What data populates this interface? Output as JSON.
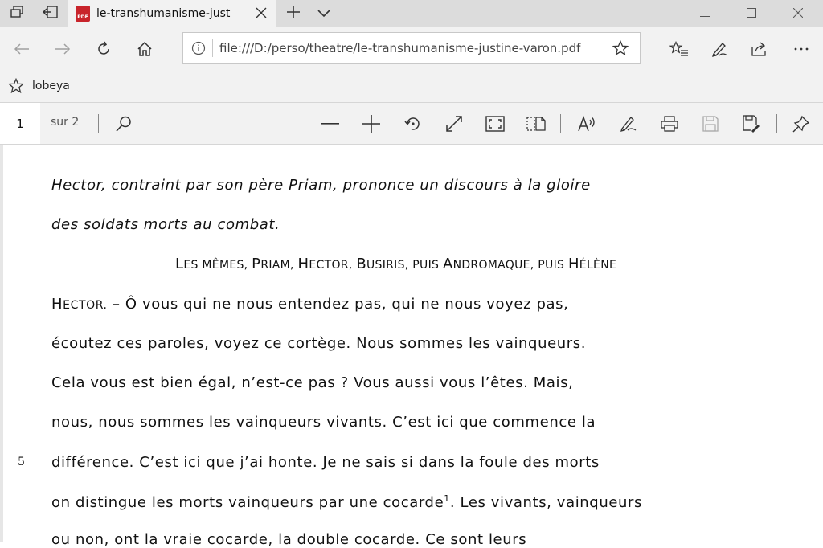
{
  "tab": {
    "title": "le-transhumanisme-just",
    "favicon_label": "PDF"
  },
  "address_bar": {
    "url": "file:///D:/perso/theatre/le-transhumanisme-justine-varon.pdf"
  },
  "favorites_bar": {
    "items": [
      {
        "label": "lobeya"
      }
    ]
  },
  "pdf_toolbar": {
    "page_current": "1",
    "page_total": "sur 2"
  },
  "document": {
    "stage_direction_1": "Hector, contraint par son père Priam, prononce un discours à la gloire",
    "stage_direction_2": "des soldats morts au combat.",
    "characters": {
      "p1": "L",
      "p2": "ES MÊMES, ",
      "p3": "P",
      "p4": "RIAM, ",
      "p5": "H",
      "p6": "ECTOR, ",
      "p7": "B",
      "p8": "USIRIS, PUIS ",
      "p9": "A",
      "p10": "NDROMAQUE, PUIS ",
      "p11": "H",
      "p12": "ÉLÈNE"
    },
    "speaker_initial": "H",
    "speaker_rest": "ECTOR.",
    "speech_line_1": " – Ô vous qui ne nous entendez pas, qui ne nous voyez pas,",
    "speech_lines": [
      "écoutez ces paroles, voyez ce cortège. Nous sommes les vainqueurs.",
      "Cela vous est bien égal, n’est-ce pas ? Vous aussi vous l’êtes. Mais,",
      "nous, nous sommes les vainqueurs vivants. C’est ici que commence la",
      "différence. C’est ici que j’ai honte. Je ne sais si dans la foule des morts"
    ],
    "line_number": "5",
    "speech_line_footnote_before": "on distingue les morts vainqueurs par une cocarde",
    "footnote_mark": "1",
    "speech_line_footnote_after": ". Les vivants, vainqueurs",
    "speech_line_last": "ou non, ont la vraie cocarde, la double cocarde. Ce sont leurs"
  }
}
